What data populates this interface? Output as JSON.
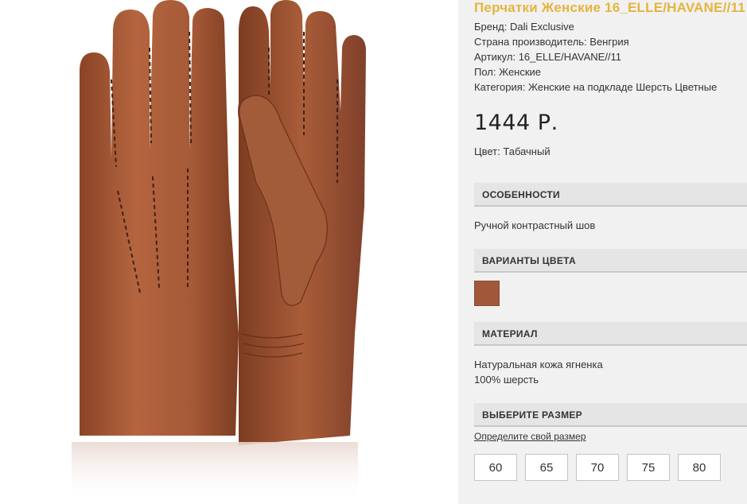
{
  "product": {
    "title": "Перчатки Женские 16_ELLE/HAVANE//11",
    "meta": [
      "Бренд: Dali Exclusive",
      "Страна производитель: Венгрия",
      "Артикул: 16_ELLE/HAVANE//11",
      "Пол: Женские",
      "Категория: Женские на подкладе Шерсть Цветные"
    ],
    "price": "1444 Р.",
    "color_line": "Цвет: Табачный"
  },
  "features": {
    "heading": "ОСОБЕННОСТИ",
    "text": "Ручной контрастный шов"
  },
  "color_variants": {
    "heading": "ВАРИАНТЫ ЦВЕТА",
    "swatches": [
      {
        "color": "#a0573a"
      }
    ]
  },
  "material": {
    "heading": "МАТЕРИАЛ",
    "lines": [
      "Натуральная кожа ягненка",
      "100% шерсть"
    ]
  },
  "size": {
    "heading": "ВЫБЕРИТЕ РАЗМЕР",
    "link_text": "Определите свой размер",
    "options": [
      "60",
      "65",
      "70",
      "75",
      "80"
    ]
  },
  "colors": {
    "title_accent": "#e6b43c",
    "glove_leather": "#a0573a"
  }
}
